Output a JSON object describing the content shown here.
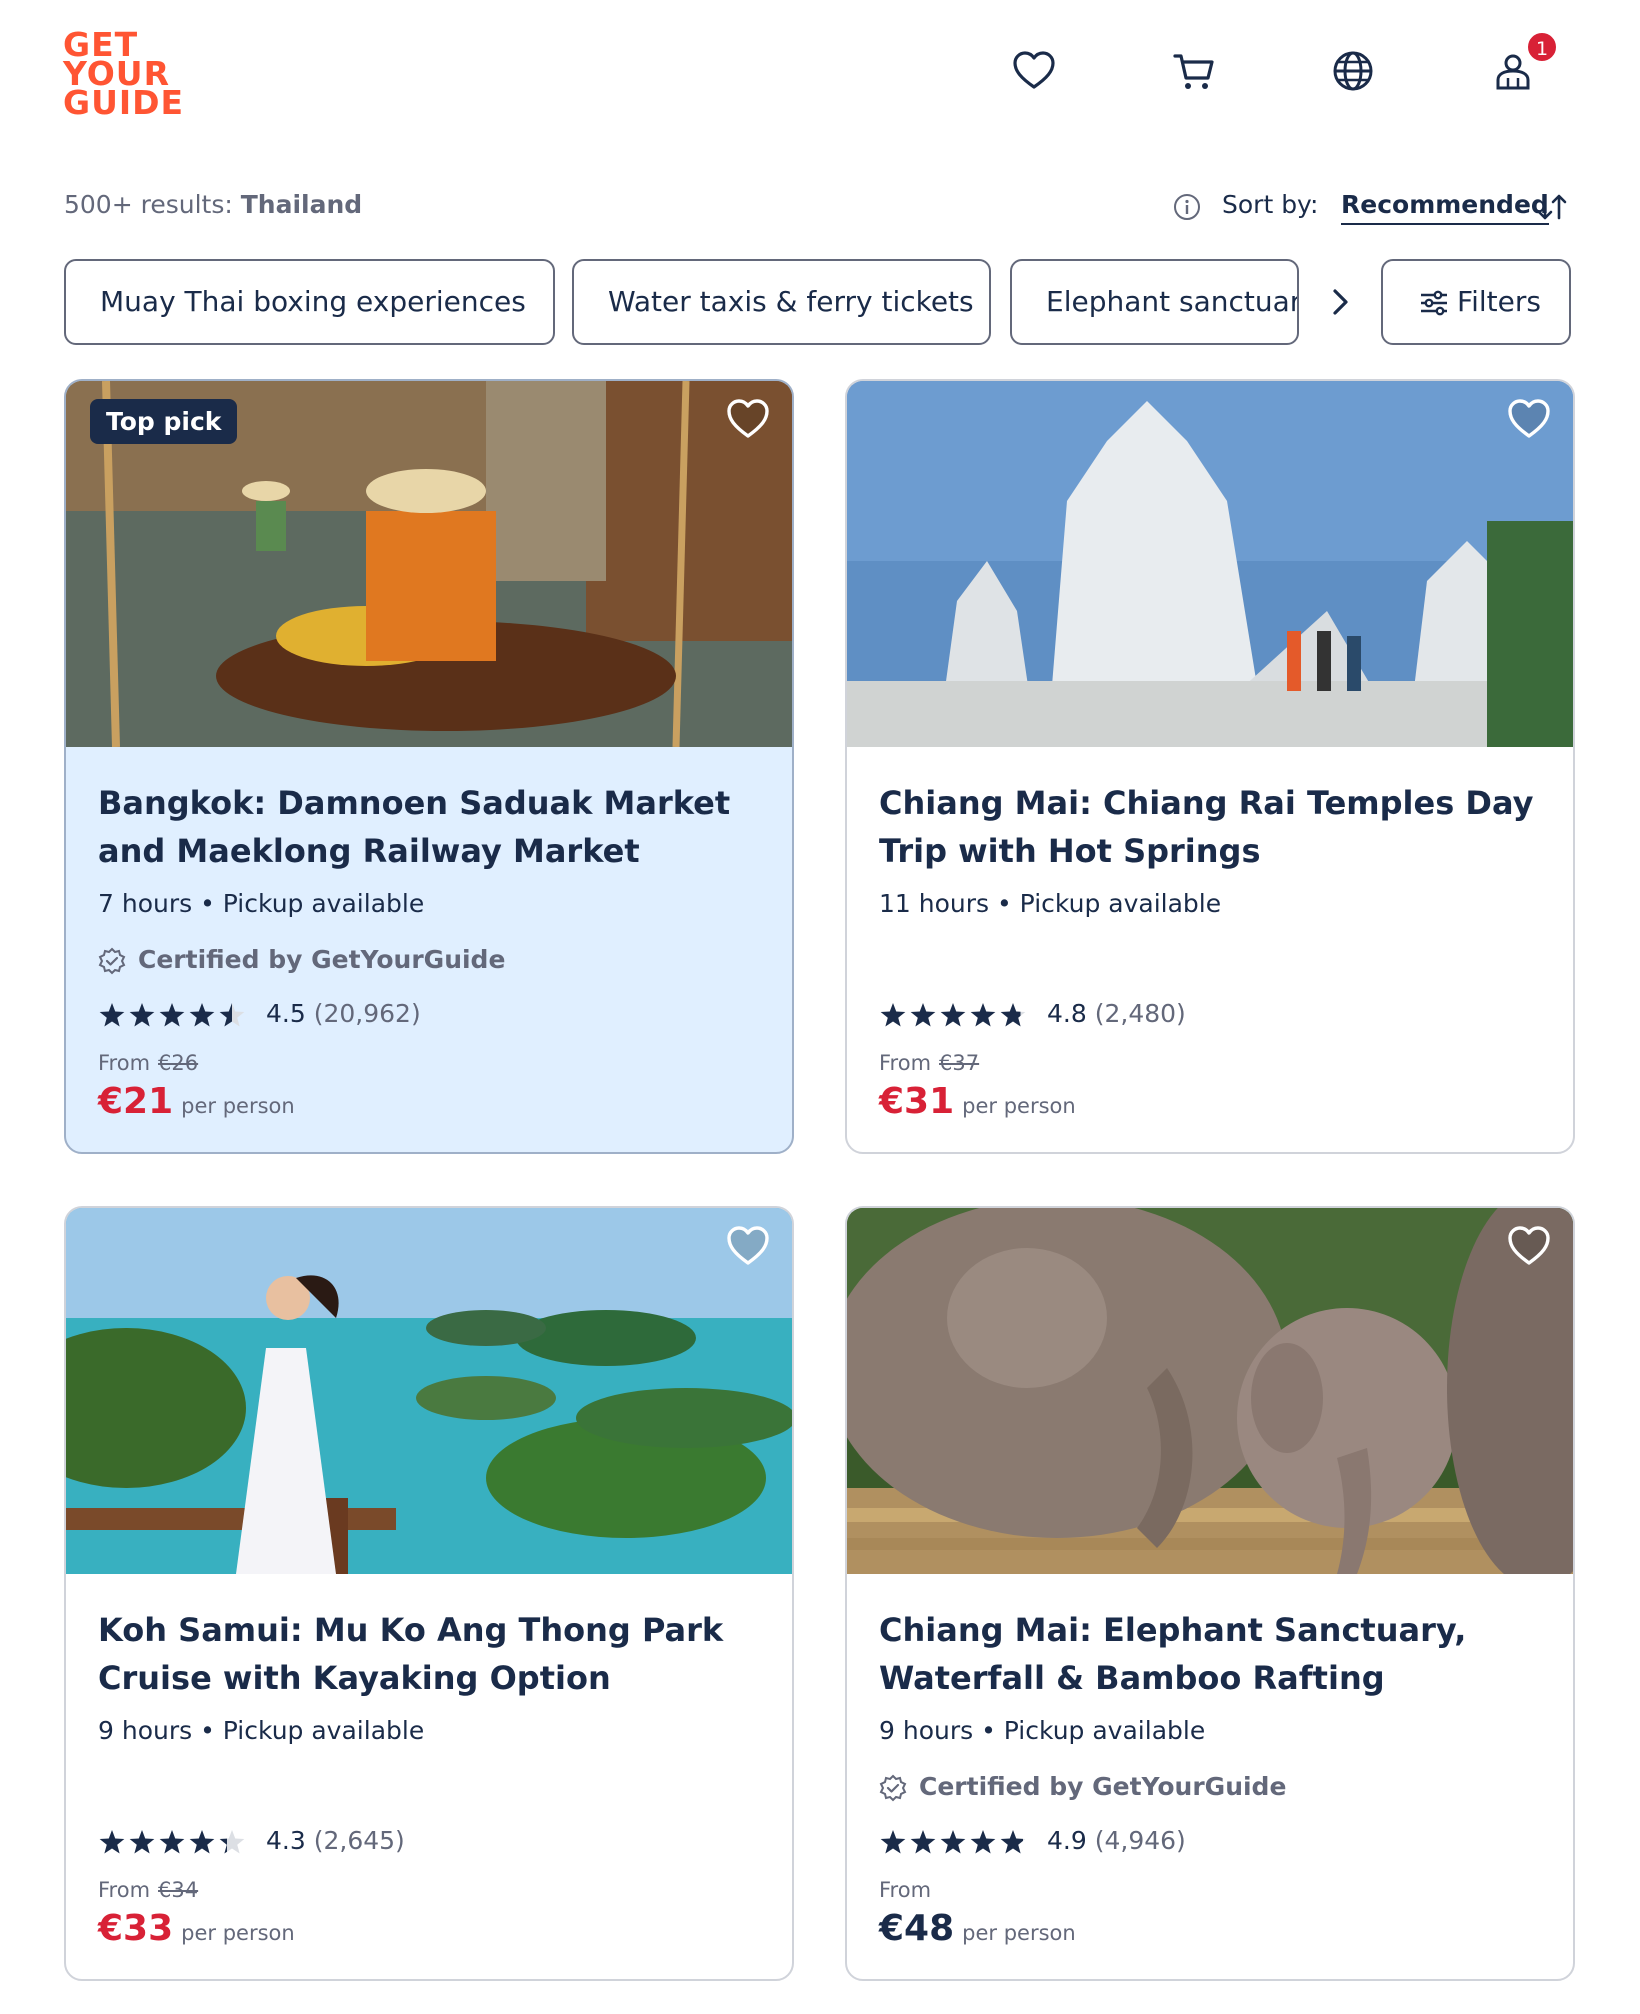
{
  "header": {
    "logo_lines": [
      "GET",
      "YOUR",
      "GUIDE"
    ],
    "icons": [
      "heart-icon",
      "cart-icon",
      "globe-icon",
      "profile-icon"
    ],
    "badge_count": "1"
  },
  "results": {
    "prefix": "500+ results:",
    "location": "Thailand",
    "sort_label": "Sort by:",
    "sort_value": "Recommended"
  },
  "chips": [
    {
      "label": "Muay Thai boxing experiences"
    },
    {
      "label": "Water taxis & ferry tickets"
    },
    {
      "label": "Elephant sanctuaries"
    }
  ],
  "filters_label": "Filters",
  "colors": {
    "brand": "#ff5533",
    "price": "#d82136",
    "text": "#1a2b49",
    "highlight": "#e0efff"
  },
  "cards": [
    {
      "tag": "Top pick",
      "title": "Bangkok: Damnoen Saduak Market and Maeklong Railway Market",
      "meta": "7 hours • Pickup available",
      "certified": "Certified by GetYourGuide",
      "rating": "4.5",
      "rating_value": 4.5,
      "reviews": "(20,962)",
      "from": "From",
      "old_price": "€26",
      "price": "€21",
      "per": "per person"
    },
    {
      "title": "Chiang Mai: Chiang Rai Temples Day Trip with Hot Springs",
      "meta": "11 hours • Pickup available",
      "rating": "4.8",
      "rating_value": 4.8,
      "reviews": "(2,480)",
      "from": "From",
      "old_price": "€37",
      "price": "€31",
      "per": "per person"
    },
    {
      "title": "Koh Samui: Mu Ko Ang Thong Park Cruise with Kayaking Option",
      "meta": "9 hours • Pickup available",
      "rating": "4.3",
      "rating_value": 4.3,
      "reviews": "(2,645)",
      "from": "From",
      "old_price": "€34",
      "price": "€33",
      "per": "per person"
    },
    {
      "title": "Chiang Mai: Elephant Sanctuary, Waterfall & Bamboo Rafting",
      "meta": "9 hours • Pickup available",
      "certified": "Certified by GetYourGuide",
      "rating": "4.9",
      "rating_value": 4.9,
      "reviews": "(4,946)",
      "from": "From",
      "price": "€48",
      "per": "per person"
    }
  ]
}
